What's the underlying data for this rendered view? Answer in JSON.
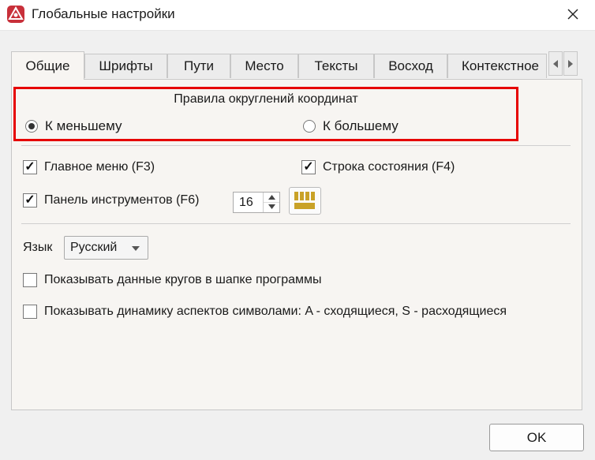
{
  "window": {
    "title": "Глобальные настройки"
  },
  "tabs": [
    {
      "label": "Общие"
    },
    {
      "label": "Шрифты"
    },
    {
      "label": "Пути"
    },
    {
      "label": "Место"
    },
    {
      "label": "Тексты"
    },
    {
      "label": "Восход"
    },
    {
      "label": "Контекстное"
    }
  ],
  "rounding": {
    "title": "Правила округлений координат",
    "option_lower": "К меньшему",
    "option_higher": "К большему",
    "selected": "К меньшему"
  },
  "options": {
    "main_menu": {
      "label": "Главное меню (F3)",
      "checked": true
    },
    "status_bar": {
      "label": "Строка состояния (F4)",
      "checked": true
    },
    "toolbar": {
      "label": "Панель инструментов (F6)",
      "checked": true
    },
    "toolbar_size": "16"
  },
  "language": {
    "label": "Язык",
    "value": "Русский"
  },
  "extra": {
    "show_circles": {
      "label": "Показывать данные кругов в шапке программы",
      "checked": false
    },
    "show_aspects": {
      "label": "Показывать динамику аспектов символами: A - сходящиеся, S - расходящиеся",
      "checked": false
    }
  },
  "buttons": {
    "ok": "OK"
  },
  "colors": {
    "highlight_border": "#e60000",
    "app_icon": "#c8303a",
    "grid_icon": "#c9a227"
  }
}
